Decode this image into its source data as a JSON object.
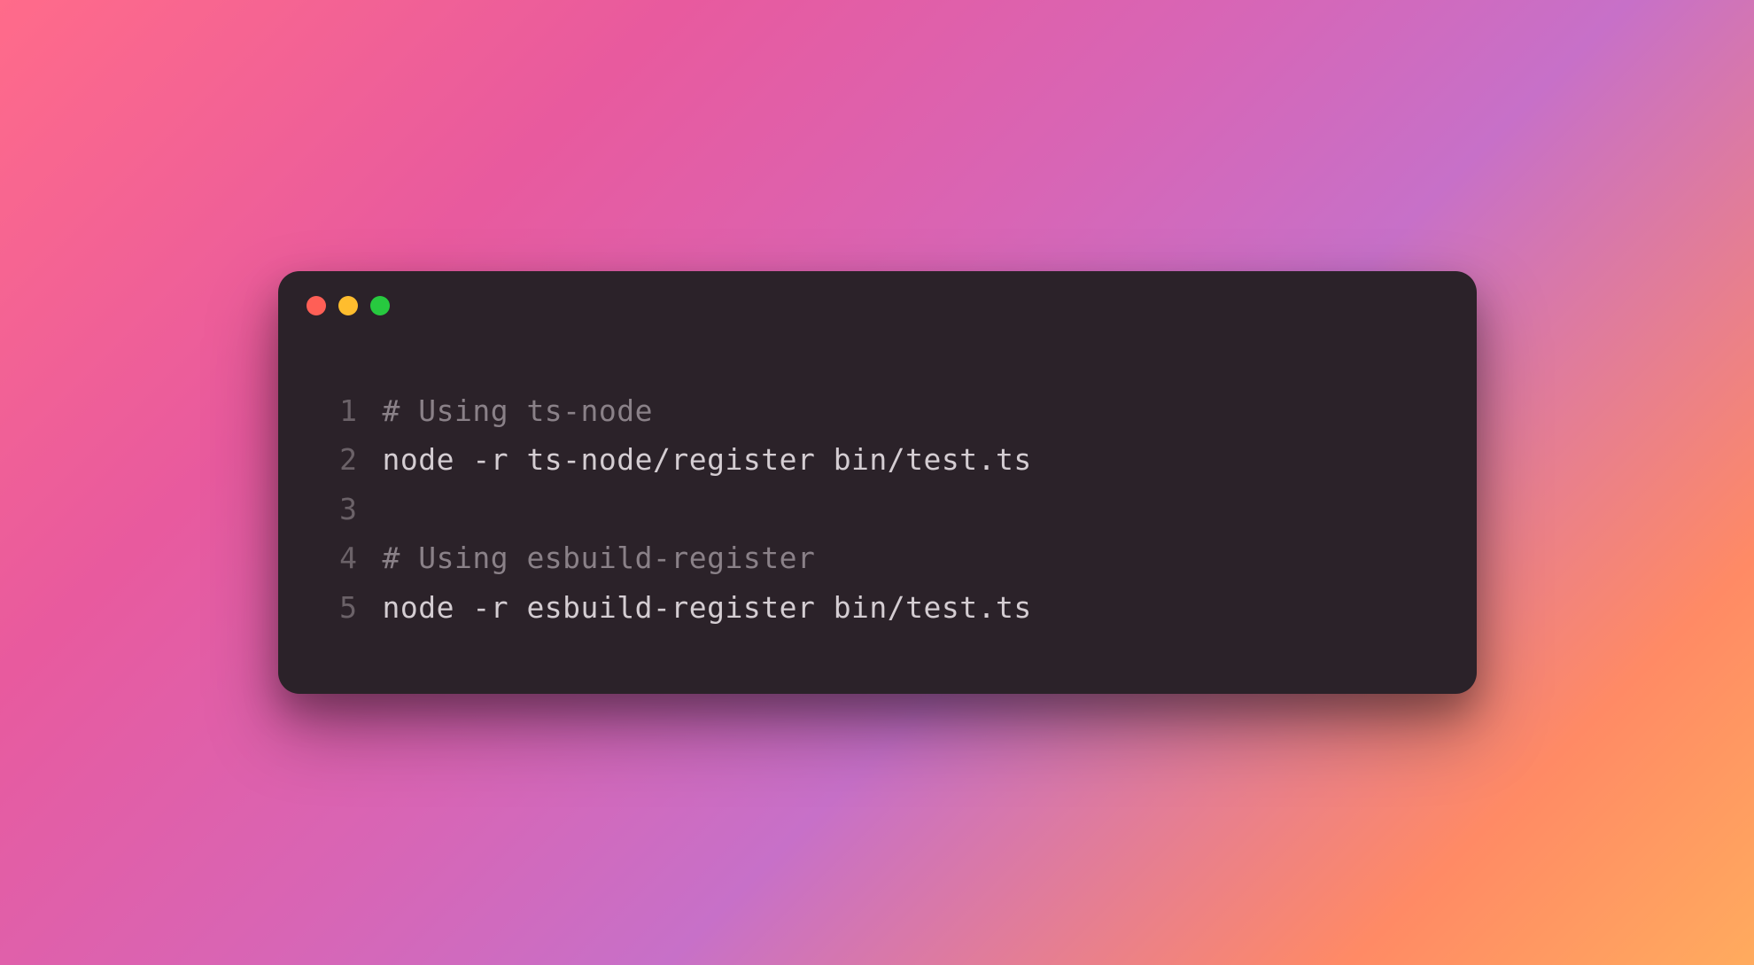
{
  "editor": {
    "lines": [
      {
        "number": "1",
        "type": "comment",
        "text": "# Using ts-node"
      },
      {
        "number": "2",
        "type": "code",
        "text": "node -r ts-node/register bin/test.ts"
      },
      {
        "number": "3",
        "type": "code",
        "text": ""
      },
      {
        "number": "4",
        "type": "comment",
        "text": "# Using esbuild-register"
      },
      {
        "number": "5",
        "type": "code",
        "text": "node -r esbuild-register bin/test.ts"
      }
    ]
  },
  "colors": {
    "window_bg": "#2b2229",
    "comment": "#8a8188",
    "code": "#d4cdd2",
    "line_number": "#6b6268",
    "traffic_red": "#ff5f56",
    "traffic_yellow": "#ffbd2e",
    "traffic_green": "#27c93f"
  }
}
